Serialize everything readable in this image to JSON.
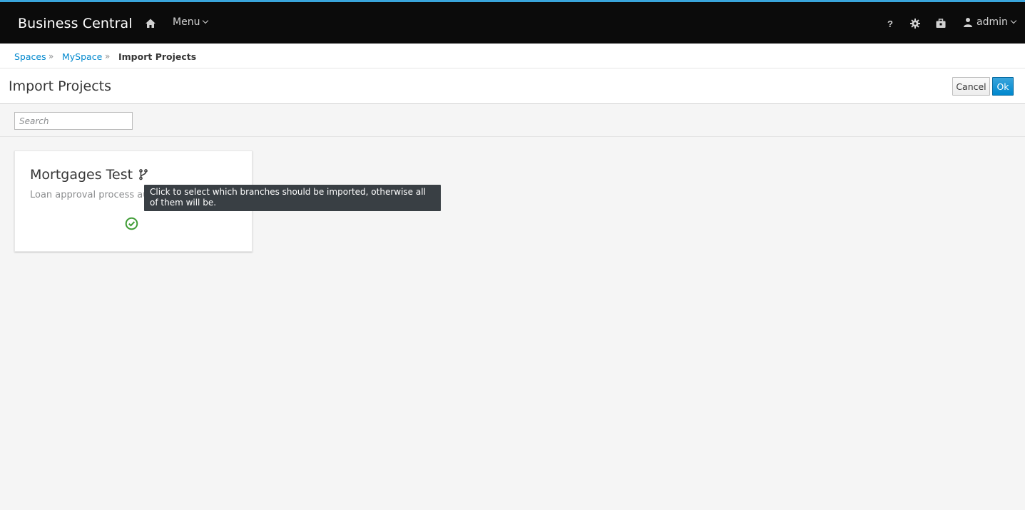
{
  "navbar": {
    "brand": "Business Central",
    "menu_label": "Menu",
    "user_label": "admin",
    "icons": [
      "home-icon",
      "help-icon",
      "gear-icon",
      "briefcase-icon",
      "user-icon"
    ],
    "help_glyph": "?",
    "accent_color": "#39a5dc"
  },
  "breadcrumb": {
    "items": [
      "Spaces",
      "MySpace",
      "Import Projects"
    ],
    "separator": "»"
  },
  "page": {
    "title": "Import Projects",
    "cancel_label": "Cancel",
    "ok_label": "Ok"
  },
  "search": {
    "placeholder": "Search",
    "value": ""
  },
  "projects": [
    {
      "name": "Mortgages Test",
      "description": "Loan approval process aut",
      "selected": true
    }
  ],
  "tooltip": {
    "text": "Click to select which branches should be imported, otherwise all of them will be."
  }
}
